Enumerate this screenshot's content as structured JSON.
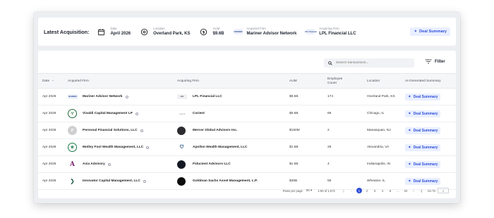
{
  "banner": {
    "title": "Latest Acquisition:",
    "date": {
      "label": "Date",
      "value": "April 2026"
    },
    "location": {
      "label": "Location",
      "value": "Overland Park, KS"
    },
    "aum": {
      "label": "AUM",
      "value": "$9.6B"
    },
    "acquired_firm": {
      "label": "Acquired Firm",
      "value": "Mariner Advisor Network",
      "logo_text": "MARINER"
    },
    "acquiring_firm": {
      "label": "Acquiring Firm",
      "value": "LPL Financial LLC",
      "logo_text": "LPL Financial"
    },
    "deal_summary_label": "Deal Summary"
  },
  "toolbar": {
    "search_placeholder": "Search transactions...",
    "filter_label": "Filter"
  },
  "table": {
    "headers": {
      "date": "Date",
      "acquired": "Acquired Firm",
      "acquiring": "Acquiring Firm",
      "aum": "AUM",
      "employees": "Employee Count",
      "location": "Location",
      "summary": "AI-Generated Summary"
    },
    "rows": [
      {
        "date": "Apr 2026",
        "acquired": "Mariner Advisor Network",
        "acquiring": "LPL Financial LLC",
        "aum": "$9.6B",
        "employees": "174",
        "location": "Overland Park, KS",
        "summary": "Deal Summary",
        "acq_logo": "MARINER",
        "acqr_logo": "LPL"
      },
      {
        "date": "Apr 2026",
        "acquired": "Vivaldi Capital Management LP",
        "acquiring": "Corient",
        "aum": "$5.6B",
        "employees": "69",
        "location": "Chicago, IL",
        "summary": "Deal Summary",
        "acq_logo": "V",
        "acqr_logo": "corient"
      },
      {
        "date": "Apr 2026",
        "acquired": "Personal Financial Solutions, LLC",
        "acquiring": "Mercer Global Advisors Inc.",
        "aum": "$150M",
        "employees": "2",
        "location": "Manasquan, NJ",
        "summary": "Deal Summary",
        "acq_logo": "P",
        "acqr_logo": ""
      },
      {
        "date": "Apr 2026",
        "acquired": "Motley Fool Wealth Management, LLC",
        "acquiring": "Apollon Wealth Management, LLC",
        "aum": "$1.6B",
        "employees": "29",
        "location": "Alexandria, VA",
        "summary": "Deal Summary",
        "acq_logo": "",
        "acqr_logo": ""
      },
      {
        "date": "Apr 2026",
        "acquired": "Axia Advisory",
        "acquiring": "Fiducient Advisors LLC",
        "aum": "$1.5B",
        "employees": "4",
        "location": "Indianapolis, IN",
        "summary": "Deal Summary",
        "acq_logo": "A",
        "acqr_logo": ""
      },
      {
        "date": "Apr 2026",
        "acquired": "Innovator Capital Management, LLC",
        "acquiring": "Goldman Sachs Asset Management, L.P.",
        "aum": "$35B",
        "employees": "55",
        "location": "Wheaton, IL",
        "summary": "Deal Summary",
        "acq_logo": "",
        "acqr_logo": ""
      }
    ]
  },
  "pager": {
    "rows_per_page_label": "Rows per page",
    "rows_per_page": "50",
    "range": "1-50 of 1,572",
    "pages": [
      "1",
      "2",
      "3",
      "4",
      "5",
      "...",
      "34"
    ],
    "active_page": "1",
    "goto_label": "Go To",
    "goto_value": "1"
  },
  "colors": {
    "accent": "#2f4fd8",
    "accent_bg": "#e9efff",
    "page_bg": "#eceef2"
  }
}
